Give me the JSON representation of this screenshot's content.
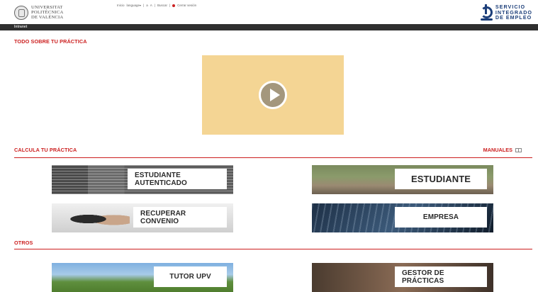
{
  "header": {
    "logo_upv_lines": [
      "UNIVERSITAT",
      "POLITÈCNICA",
      "DE VALÈNCIA"
    ],
    "nav": {
      "inicio": "Inicio",
      "language": "language",
      "font_small": "a",
      "font_large": "A",
      "buscar": "Buscar",
      "separator": "|",
      "cerrar_sesion": "Cerrar sesión"
    },
    "logo_sie_lines": [
      "SERVICIO",
      "INTEGRADO",
      "DE EMPLEO"
    ]
  },
  "darkbar": {
    "label": "Intranet"
  },
  "sections": {
    "todo": "TODO SOBRE TU PRÁCTICA",
    "calcula": "CALCULA TU PRÁCTICA",
    "manuales": "MANUALES",
    "otros": "OTROS"
  },
  "tiles": {
    "estudiante_autenticado": "ESTUDIANTE AUTENTICADO",
    "estudiante": "ESTUDIANTE",
    "recuperar_convenio": "RECUPERAR CONVENIO",
    "empresa": "EMPRESA",
    "tutor_upv": "TUTOR UPV",
    "gestor_practicas": "GESTOR DE PRÁCTICAS"
  },
  "colors": {
    "accent_red": "#cc1f1f",
    "video_bg": "#f4d594",
    "dark_bar": "#2f2f2f",
    "sie_blue": "#1d3f7a"
  }
}
